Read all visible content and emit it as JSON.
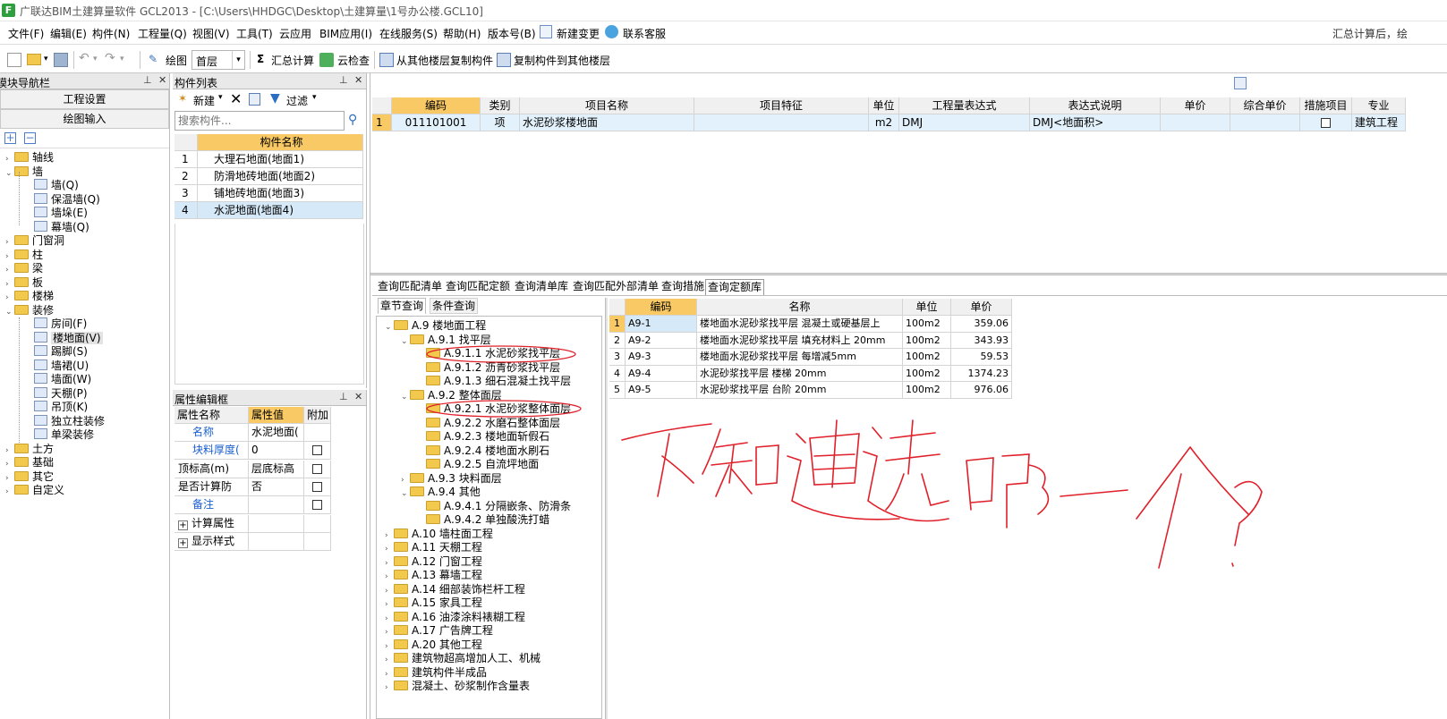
{
  "title": "广联达BIM土建算量软件 GCL2013 - [C:\\Users\\HHDGC\\Desktop\\土建算量\\1号办公楼.GCL10]",
  "app_icon": "F",
  "menu": [
    "文件(F)",
    "编辑(E)",
    "构件(N)",
    "工程量(Q)",
    "视图(V)",
    "工具(T)",
    "云应用",
    "BIM应用(I)",
    "在线服务(S)",
    "帮助(H)",
    "版本号(B)",
    "新建变更",
    "联系客服"
  ],
  "menu_right": "汇总计算后，绘",
  "toolbar": {
    "draw": "绘图",
    "floor": "首层",
    "sum": "汇总计算",
    "cloud_check": "云检查",
    "copy_from": "从其他楼层复制构件",
    "copy_to": "复制构件到其他楼层"
  },
  "nav": {
    "title": "模块导航栏",
    "btn1": "工程设置",
    "btn2": "绘图输入",
    "tree": [
      {
        "label": "轴线",
        "level": 0,
        "type": "folder",
        "exp": "›"
      },
      {
        "label": "墙",
        "level": 0,
        "type": "folder",
        "exp": "⌄"
      },
      {
        "label": "墙(Q)",
        "level": 1,
        "type": "leaf"
      },
      {
        "label": "保温墙(Q)",
        "level": 1,
        "type": "leaf"
      },
      {
        "label": "墙垛(E)",
        "level": 1,
        "type": "leaf"
      },
      {
        "label": "幕墙(Q)",
        "level": 1,
        "type": "leaf"
      },
      {
        "label": "门窗洞",
        "level": 0,
        "type": "folder",
        "exp": "›"
      },
      {
        "label": "柱",
        "level": 0,
        "type": "folder",
        "exp": "›"
      },
      {
        "label": "梁",
        "level": 0,
        "type": "folder",
        "exp": "›"
      },
      {
        "label": "板",
        "level": 0,
        "type": "folder",
        "exp": "›"
      },
      {
        "label": "楼梯",
        "level": 0,
        "type": "folder",
        "exp": "›"
      },
      {
        "label": "装修",
        "level": 0,
        "type": "folder",
        "exp": "⌄"
      },
      {
        "label": "房间(F)",
        "level": 1,
        "type": "leaf"
      },
      {
        "label": "楼地面(V)",
        "level": 1,
        "type": "leaf",
        "selected": true
      },
      {
        "label": "踢脚(S)",
        "level": 1,
        "type": "leaf"
      },
      {
        "label": "墙裙(U)",
        "level": 1,
        "type": "leaf"
      },
      {
        "label": "墙面(W)",
        "level": 1,
        "type": "leaf"
      },
      {
        "label": "天棚(P)",
        "level": 1,
        "type": "leaf"
      },
      {
        "label": "吊顶(K)",
        "level": 1,
        "type": "leaf"
      },
      {
        "label": "独立柱装修",
        "level": 1,
        "type": "leaf"
      },
      {
        "label": "单梁装修",
        "level": 1,
        "type": "leaf"
      },
      {
        "label": "土方",
        "level": 0,
        "type": "folder",
        "exp": "›"
      },
      {
        "label": "基础",
        "level": 0,
        "type": "folder",
        "exp": "›"
      },
      {
        "label": "其它",
        "level": 0,
        "type": "folder",
        "exp": "›"
      },
      {
        "label": "自定义",
        "level": 0,
        "type": "folder",
        "exp": "›"
      }
    ]
  },
  "comp_list": {
    "title": "构件列表",
    "new": "新建",
    "filter": "过滤",
    "search_placeholder": "搜索构件...",
    "header": "构件名称",
    "rows": [
      {
        "no": "1",
        "name": "大理石地面(地面1)"
      },
      {
        "no": "2",
        "name": "防滑地砖地面(地面2)"
      },
      {
        "no": "3",
        "name": "铺地砖地面(地面3)"
      },
      {
        "no": "4",
        "name": "水泥地面(地面4)",
        "selected": true
      }
    ]
  },
  "props": {
    "title": "属性编辑框",
    "headers": [
      "属性名称",
      "属性值",
      "附加"
    ],
    "rows": [
      {
        "name": "名称",
        "value": "水泥地面(",
        "blue": true,
        "chk": false
      },
      {
        "name": "块料厚度(",
        "value": "0",
        "blue": true,
        "chk": true
      },
      {
        "name": "顶标高(m)",
        "value": "层底标高",
        "blue": false,
        "chk": true
      },
      {
        "name": "是否计算防",
        "value": "否",
        "blue": false,
        "chk": true
      },
      {
        "name": "备注",
        "value": "",
        "blue": true,
        "chk": true
      },
      {
        "name": "计算属性",
        "value": "",
        "blue": false,
        "chk": false,
        "plus": true
      },
      {
        "name": "显示样式",
        "value": "",
        "blue": false,
        "chk": false,
        "plus": true
      }
    ]
  },
  "main_table": {
    "headers": [
      "编码",
      "类别",
      "项目名称",
      "项目特征",
      "单位",
      "工程量表达式",
      "表达式说明",
      "单价",
      "综合单价",
      "措施项目",
      "专业"
    ],
    "rows": [
      {
        "no": "1",
        "code": "011101001",
        "type": "项",
        "name": "水泥砂浆楼地面",
        "feature": "",
        "unit": "m2",
        "expr": "DMJ",
        "desc": "DMJ<地面积>",
        "price": "",
        "comp_price": "",
        "measure": false,
        "major": "建筑工程"
      }
    ]
  },
  "query_tabs": [
    "查询匹配清单",
    "查询匹配定额",
    "查询清单库",
    "查询匹配外部清单",
    "查询措施",
    "查询定额库"
  ],
  "sub_tabs": [
    "章节查询",
    "条件查询"
  ],
  "chapter_tree": [
    {
      "label": "A.9 楼地面工程",
      "level": 0,
      "exp": "⌄"
    },
    {
      "label": "A.9.1 找平层",
      "level": 1,
      "exp": "⌄"
    },
    {
      "label": "A.9.1.1 水泥砂浆找平层",
      "level": 2,
      "exp": ""
    },
    {
      "label": "A.9.1.2 沥青砂浆找平层",
      "level": 2,
      "exp": ""
    },
    {
      "label": "A.9.1.3 细石混凝土找平层",
      "level": 2,
      "exp": ""
    },
    {
      "label": "A.9.2 整体面层",
      "level": 1,
      "exp": "⌄"
    },
    {
      "label": "A.9.2.1 水泥砂浆整体面层",
      "level": 2,
      "exp": ""
    },
    {
      "label": "A.9.2.2 水磨石整体面层",
      "level": 2,
      "exp": ""
    },
    {
      "label": "A.9.2.3 楼地面斩假石",
      "level": 2,
      "exp": ""
    },
    {
      "label": "A.9.2.4 楼地面水刷石",
      "level": 2,
      "exp": ""
    },
    {
      "label": "A.9.2.5 自流坪地面",
      "level": 2,
      "exp": ""
    },
    {
      "label": "A.9.3 块料面层",
      "level": 1,
      "exp": "›"
    },
    {
      "label": "A.9.4 其他",
      "level": 1,
      "exp": "⌄"
    },
    {
      "label": "A.9.4.1 分隔嵌条、防滑条",
      "level": 2,
      "exp": ""
    },
    {
      "label": "A.9.4.2 单独酸洗打蜡",
      "level": 2,
      "exp": ""
    },
    {
      "label": "A.10 墙柱面工程",
      "level": 0,
      "exp": "›"
    },
    {
      "label": "A.11 天棚工程",
      "level": 0,
      "exp": "›"
    },
    {
      "label": "A.12 门窗工程",
      "level": 0,
      "exp": "›"
    },
    {
      "label": "A.13 幕墙工程",
      "level": 0,
      "exp": "›"
    },
    {
      "label": "A.14 细部装饰栏杆工程",
      "level": 0,
      "exp": "›"
    },
    {
      "label": "A.15 家具工程",
      "level": 0,
      "exp": "›"
    },
    {
      "label": "A.16 油漆涂料裱糊工程",
      "level": 0,
      "exp": "›"
    },
    {
      "label": "A.17 广告牌工程",
      "level": 0,
      "exp": "›"
    },
    {
      "label": "A.20 其他工程",
      "level": 0,
      "exp": "›"
    },
    {
      "label": "建筑物超高增加人工、机械",
      "level": 0,
      "exp": "›"
    },
    {
      "label": "建筑构件半成品",
      "level": 0,
      "exp": "›"
    },
    {
      "label": "混凝土、砂浆制作含量表",
      "level": 0,
      "exp": "›"
    }
  ],
  "quota_table": {
    "headers": [
      "编码",
      "名称",
      "单位",
      "单价"
    ],
    "rows": [
      {
        "no": "1",
        "code": "A9-1",
        "name": "楼地面水泥砂浆找平层 混凝土或硬基层上",
        "unit": "100m2",
        "price": "359.06"
      },
      {
        "no": "2",
        "code": "A9-2",
        "name": "楼地面水泥砂浆找平层 填充材料上 20mm",
        "unit": "100m2",
        "price": "343.93"
      },
      {
        "no": "3",
        "code": "A9-3",
        "name": "楼地面水泥砂浆找平层 每增减5mm",
        "unit": "100m2",
        "price": "59.53"
      },
      {
        "no": "4",
        "code": "A9-4",
        "name": "水泥砂浆找平层 楼梯 20mm",
        "unit": "100m2",
        "price": "1374.23"
      },
      {
        "no": "5",
        "code": "A9-5",
        "name": "水泥砂浆找平层 台阶 20mm",
        "unit": "100m2",
        "price": "976.06"
      }
    ]
  },
  "handwriting": "不知道选哪一个?",
  "colors": {
    "selected_header": "#f8c964",
    "selected_row": "#d6e9f8",
    "annotation": "#e0202a",
    "link_blue": "#1a5fd0"
  }
}
